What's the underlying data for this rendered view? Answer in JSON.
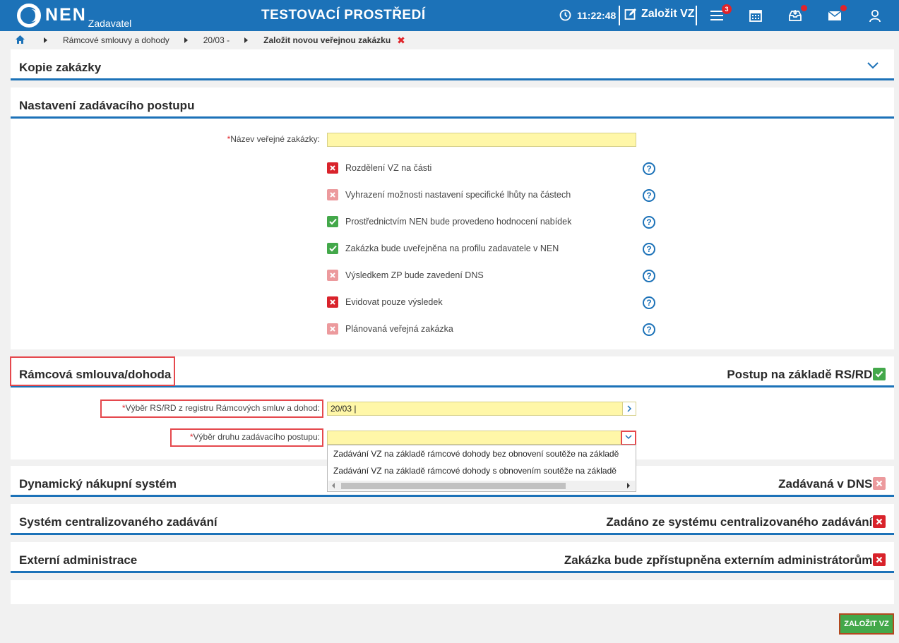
{
  "header": {
    "logo_text": "NEN",
    "logo_sub": "Zadavatel",
    "env_title": "TESTOVACÍ PROSTŘEDÍ",
    "clock": "11:22:48",
    "new_vz_label": "Založit VZ",
    "menu_badge": "3"
  },
  "breadcrumb": {
    "items": [
      "Rámcové smlouvy a dohody",
      "20/03 -"
    ],
    "current": "Založit novou veřejnou zakázku",
    "close_glyph": "✖"
  },
  "sections": {
    "kopie": {
      "title": "Kopie zakázky"
    },
    "nastaveni": {
      "title": "Nastavení zadávacího postupu",
      "name_label": "Název veřejné zakázky:",
      "name_value": "",
      "checkboxes": [
        {
          "label": "Rozdělení VZ na části",
          "state": "red"
        },
        {
          "label": "Vyhrazení možnosti nastavení specifické lhůty na částech",
          "state": "pink"
        },
        {
          "label": "Prostřednictvím NEN bude provedeno hodnocení nabídek",
          "state": "green"
        },
        {
          "label": "Zakázka bude uveřejněna na profilu zadavatele v NEN",
          "state": "green"
        },
        {
          "label": "Výsledkem ZP bude zavedení DNS",
          "state": "pink"
        },
        {
          "label": "Evidovat pouze výsledek",
          "state": "red"
        },
        {
          "label": "Plánovaná veřejná zakázka",
          "state": "pink"
        }
      ]
    },
    "ramcova": {
      "title": "Rámcová smlouva/dohoda",
      "right_label": "Postup na základě RS/RD:",
      "rsrd_label": "Výběr RS/RD z registru Rámcových smluv a dohod:",
      "rsrd_value": "20/03 |",
      "druh_label": "Výběr druhu zadávacího postupu:",
      "druh_value": "",
      "options": [
        "Zadávání VZ na základě rámcové dohody bez obnovení soutěže na základě",
        "Zadávání VZ na základě rámcové dohody s obnovením soutěže na základě"
      ]
    },
    "dns": {
      "title": "Dynamický nákupní systém",
      "right_label": "Zadávaná v DNS:"
    },
    "centralizovane": {
      "title": "Systém centralizovaného zadávání",
      "right_label": "Zadáno ze systému centralizovaného zadávání:"
    },
    "externi": {
      "title": "Externí administrace",
      "right_label": "Zakázka bude zpřístupněna externím administrátorům:"
    }
  },
  "submit_label": "ZALOŽIT VZ",
  "colors": {
    "brand": "#1c72b8",
    "check_green": "#43a84a",
    "cross_red": "#d9232b",
    "cross_pink": "#ec9a9d",
    "input_yellow": "#fff7a8"
  }
}
